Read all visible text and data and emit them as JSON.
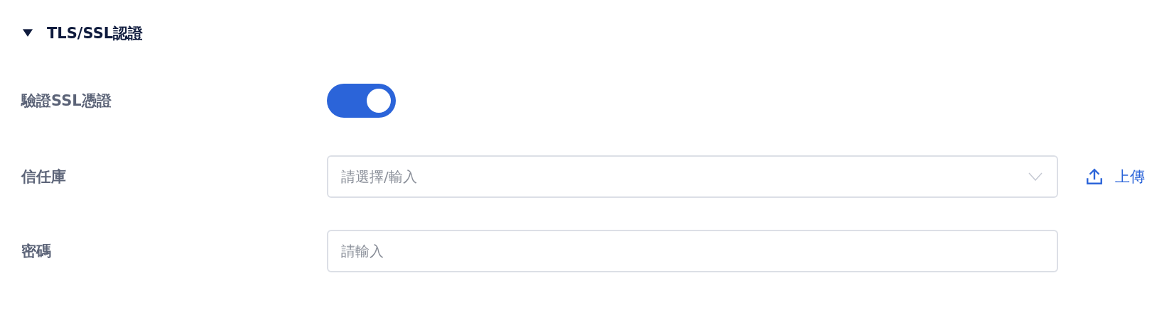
{
  "section": {
    "title": "TLS/SSL認證",
    "expanded": true
  },
  "rows": [
    {
      "kind": "toggle",
      "label": "驗證SSL憑證",
      "on": true
    },
    {
      "kind": "select",
      "label": "信任庫",
      "placeholder": "請選擇/輸入",
      "action": "上傳"
    },
    {
      "kind": "input",
      "label": "密碼",
      "placeholder": "請輸入"
    }
  ]
}
